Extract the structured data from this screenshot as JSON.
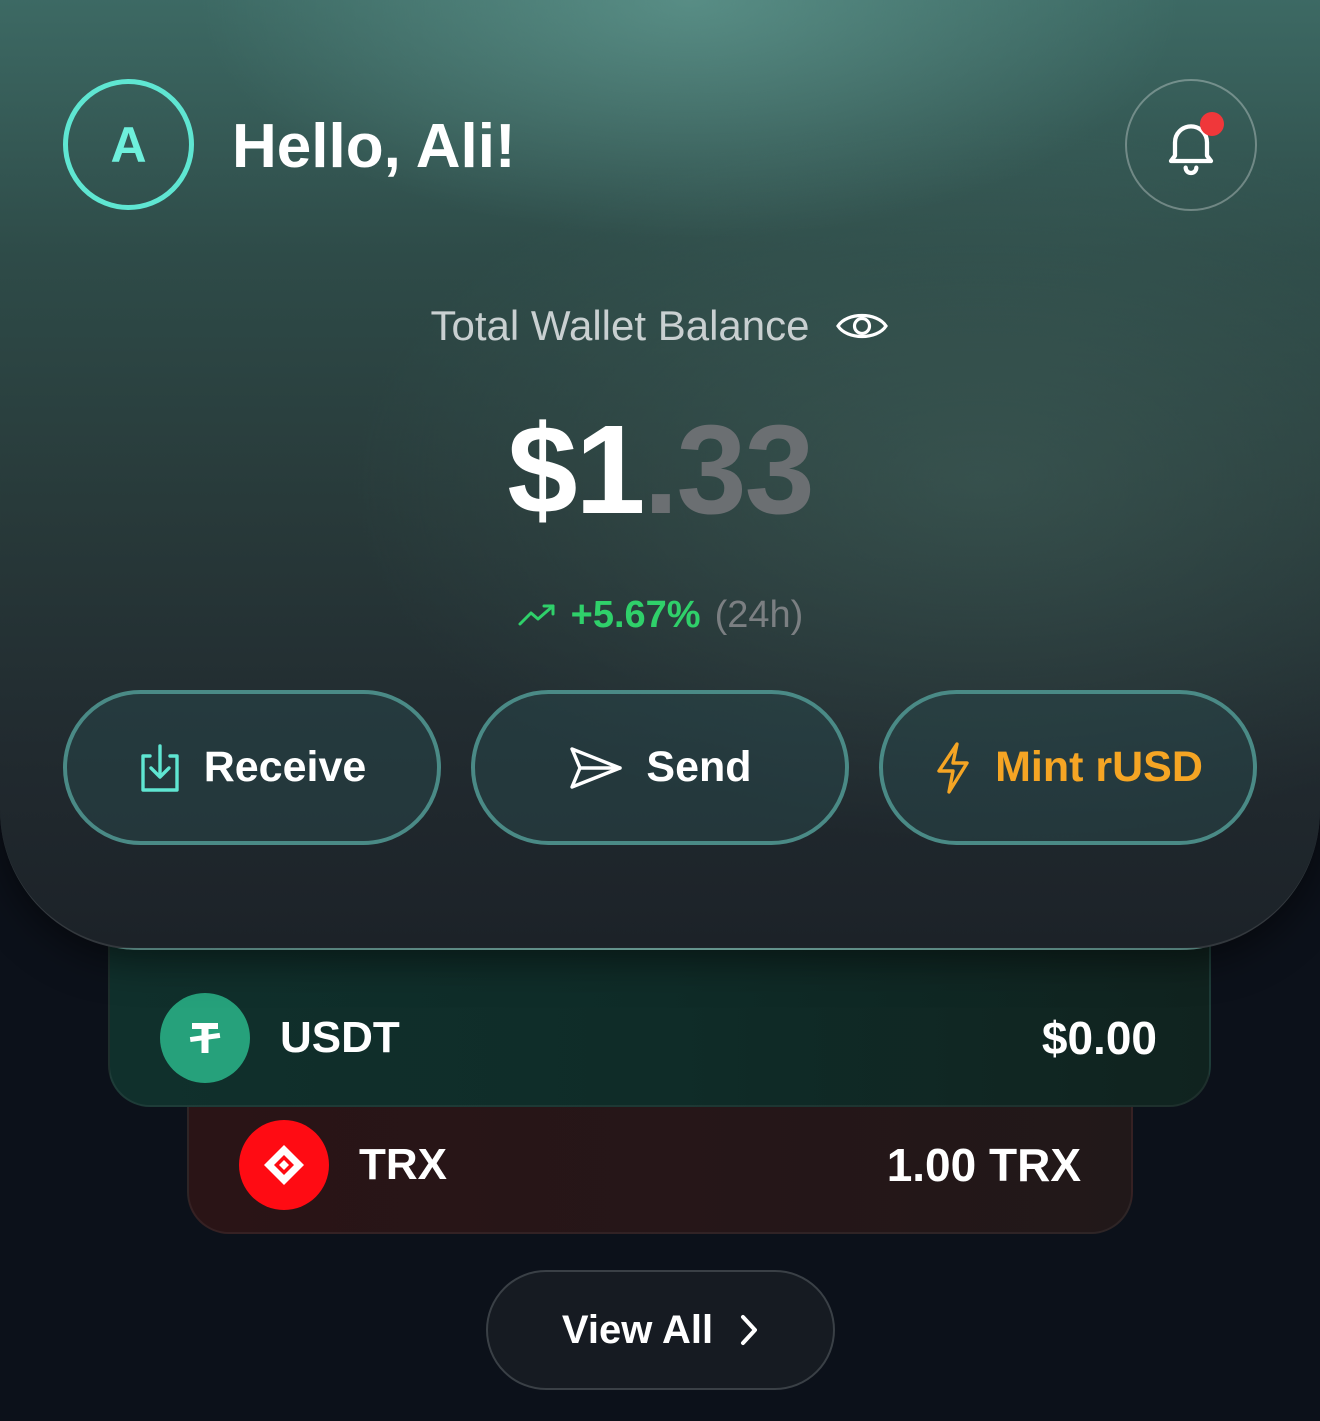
{
  "header": {
    "avatar_initial": "A",
    "greeting": "Hello, Ali!",
    "notification_icon": "bell-icon",
    "has_unread_notification": true
  },
  "balance": {
    "label": "Total Wallet Balance",
    "visibility_icon": "eye-icon",
    "amount_whole": "$1",
    "amount_decimal": ".33",
    "change_icon": "trending-up-icon",
    "change_percent": "+5.67%",
    "change_period": "(24h)"
  },
  "actions": {
    "receive": {
      "label": "Receive",
      "icon": "download-icon"
    },
    "send": {
      "label": "Send",
      "icon": "paper-plane-icon"
    },
    "mint": {
      "label": "Mint rUSD",
      "icon": "lightning-icon"
    }
  },
  "tokens": [
    {
      "symbol": "USDT",
      "value": "$0.00",
      "icon": "tether-icon"
    },
    {
      "symbol": "TRX",
      "value": "1.00 TRX",
      "icon": "tron-icon"
    }
  ],
  "footer": {
    "view_all_label": "View All",
    "view_all_icon": "chevron-right-icon"
  },
  "colors": {
    "accent_teal": "#5fe6d2",
    "positive_green": "#2fd06a",
    "mint_orange": "#f5a524",
    "notification_red": "#f0373a",
    "usdt_green": "#26a17b",
    "trx_red": "#ff0b13"
  }
}
